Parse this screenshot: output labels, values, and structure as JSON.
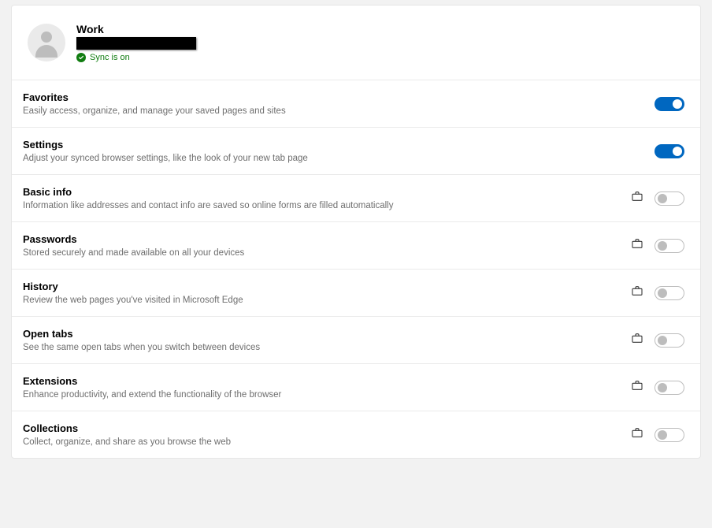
{
  "profile": {
    "name": "Work",
    "sync_status": "Sync is on"
  },
  "rows": [
    {
      "title": "Favorites",
      "desc": "Easily access, organize, and manage your saved pages and sites",
      "on": true,
      "managed": false
    },
    {
      "title": "Settings",
      "desc": "Adjust your synced browser settings, like the look of your new tab page",
      "on": true,
      "managed": false
    },
    {
      "title": "Basic info",
      "desc": "Information like addresses and contact info are saved so online forms are filled automatically",
      "on": false,
      "managed": true
    },
    {
      "title": "Passwords",
      "desc": "Stored securely and made available on all your devices",
      "on": false,
      "managed": true
    },
    {
      "title": "History",
      "desc": "Review the web pages you've visited in Microsoft Edge",
      "on": false,
      "managed": true
    },
    {
      "title": "Open tabs",
      "desc": "See the same open tabs when you switch between devices",
      "on": false,
      "managed": true
    },
    {
      "title": "Extensions",
      "desc": "Enhance productivity, and extend the functionality of the browser",
      "on": false,
      "managed": true
    },
    {
      "title": "Collections",
      "desc": "Collect, organize, and share as you browse the web",
      "on": false,
      "managed": true
    }
  ]
}
